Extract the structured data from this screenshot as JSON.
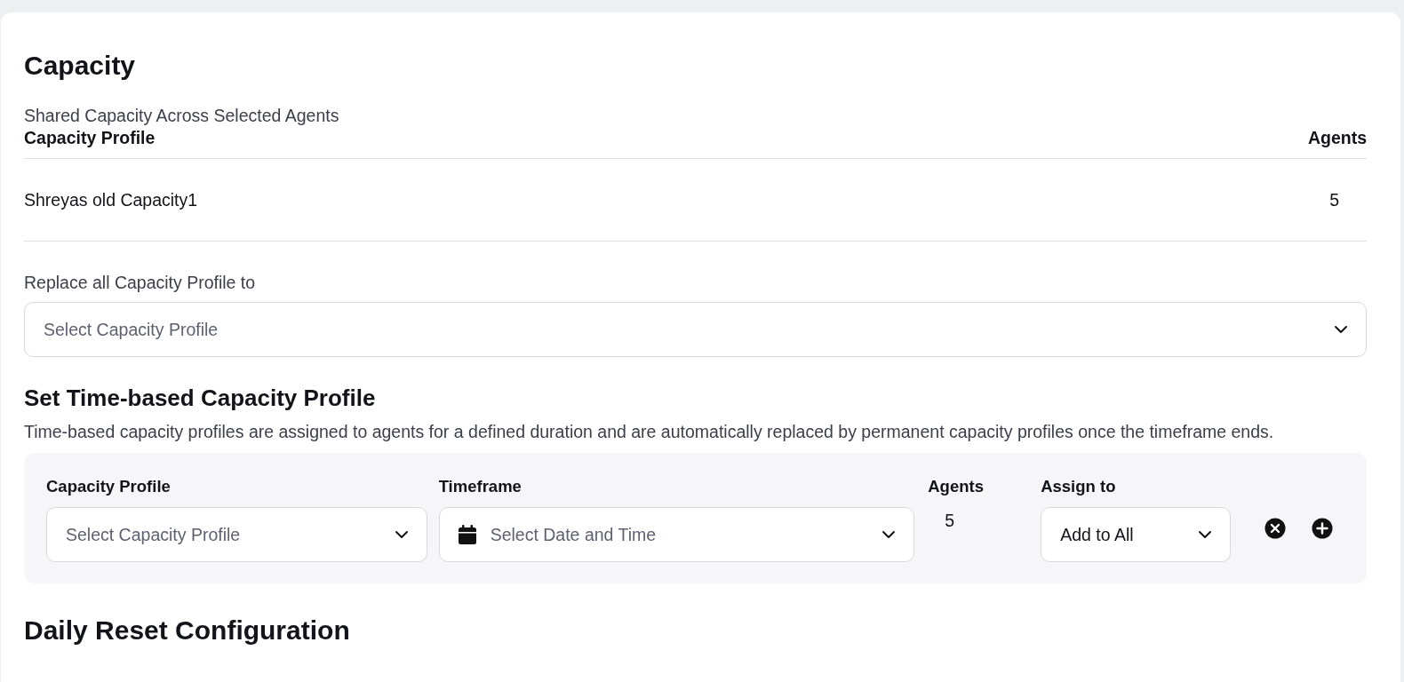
{
  "title": "Capacity",
  "shared_capacity": {
    "caption": "Shared Capacity Across Selected Agents",
    "columns": [
      "Capacity Profile",
      "Agents"
    ],
    "rows": [
      {
        "capacity_profile": "Shreyas old Capacity1",
        "agents": "5"
      }
    ]
  },
  "replace_all": {
    "label": "Replace all Capacity Profile to",
    "placeholder": "Select Capacity Profile"
  },
  "time_based": {
    "title": "Set Time-based Capacity Profile",
    "description": "Time-based capacity profiles are assigned to agents for a defined duration and are automatically replaced by permanent capacity profiles once the timeframe ends.",
    "rows": [
      {
        "capacity_profile": {
          "label": "Capacity Profile",
          "placeholder": "Select Capacity Profile"
        },
        "timeframe": {
          "label": "Timeframe",
          "placeholder": "Select Date and Time"
        },
        "agents": {
          "label": "Agents",
          "value": "5"
        },
        "assign_to": {
          "label": "Assign to",
          "value": "Add to All"
        }
      }
    ]
  },
  "daily_reset": {
    "title": "Daily Reset Configuration"
  }
}
